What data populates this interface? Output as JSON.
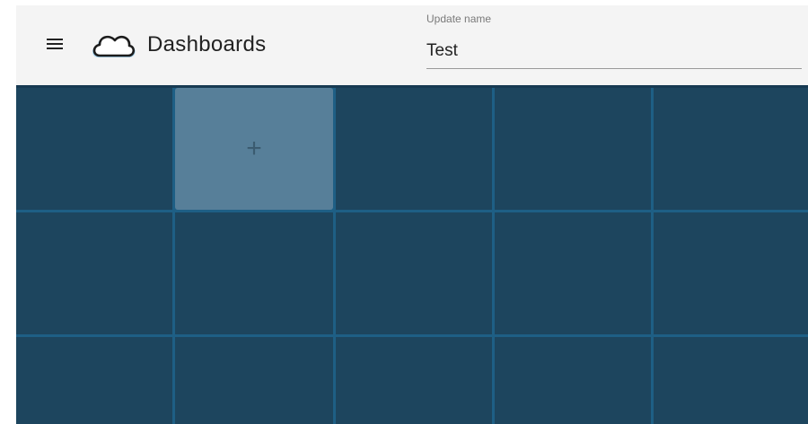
{
  "header": {
    "title": "Dashboards",
    "menu_icon": "hamburger-menu-icon",
    "logo_icon": "cloud-icon"
  },
  "name_field": {
    "label": "Update name",
    "value": "Test"
  },
  "grid": {
    "add_label": "+"
  },
  "colors": {
    "topbar_bg": "#f4f4f4",
    "grid_line": "#1e5f85",
    "cell_bg": "#1d455e",
    "add_cell_bg": "#577f99",
    "cloud_stroke": "#1c1c1c",
    "cloud_fill": "#8ec6e6"
  }
}
